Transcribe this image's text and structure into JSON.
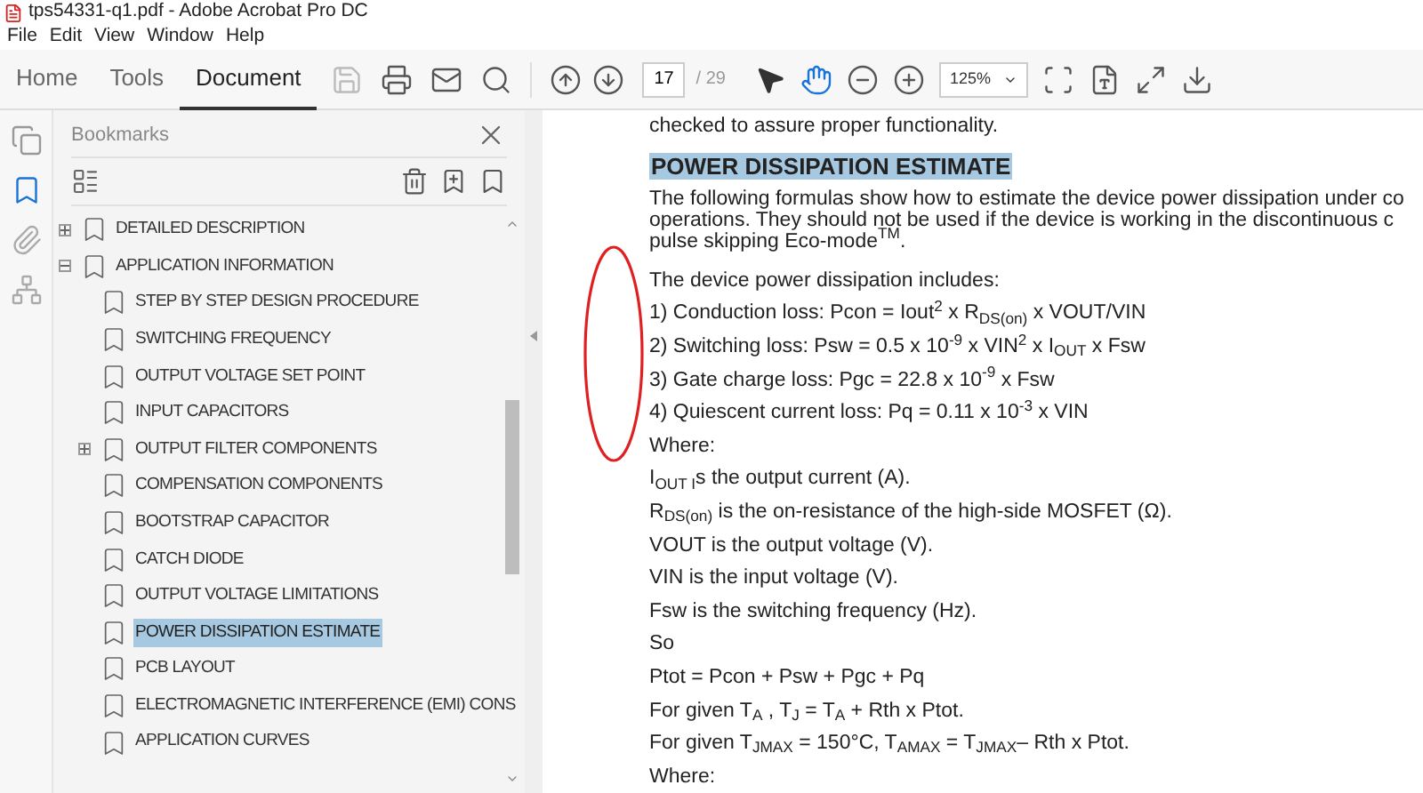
{
  "window": {
    "title": "tps54331-q1.pdf - Adobe Acrobat Pro DC"
  },
  "menu": [
    "File",
    "Edit",
    "View",
    "Window",
    "Help"
  ],
  "tabs": [
    {
      "label": "Home",
      "selected": false
    },
    {
      "label": "Tools",
      "selected": false
    },
    {
      "label": "Document",
      "selected": true
    }
  ],
  "toolbar": {
    "page": "17",
    "page_count": "/ 29",
    "zoom": "125%"
  },
  "bookmarks": {
    "title": "Bookmarks",
    "items": [
      {
        "label": "DETAILED DESCRIPTION",
        "selected": false,
        "expanded": false
      },
      {
        "label": "APPLICATION INFORMATION",
        "selected": false,
        "expanded": true,
        "children": [
          {
            "label": "STEP BY STEP DESIGN PROCEDURE",
            "selected": false
          },
          {
            "label": "SWITCHING FREQUENCY",
            "selected": false
          },
          {
            "label": "OUTPUT VOLTAGE SET POINT",
            "selected": false
          },
          {
            "label": "INPUT CAPACITORS",
            "selected": false
          },
          {
            "label": "OUTPUT FILTER COMPONENTS",
            "selected": false,
            "expanded": false
          },
          {
            "label": "COMPENSATION COMPONENTS",
            "selected": false
          },
          {
            "label": "BOOTSTRAP CAPACITOR",
            "selected": false
          },
          {
            "label": "CATCH DIODE",
            "selected": false
          },
          {
            "label": "OUTPUT VOLTAGE LIMITATIONS",
            "selected": false
          },
          {
            "label": "POWER DISSIPATION ESTIMATE",
            "selected": true
          },
          {
            "label": "PCB LAYOUT",
            "selected": false
          },
          {
            "label": "ELECTROMAGNETIC INTERFERENCE (EMI) CONS",
            "selected": false
          },
          {
            "label": "APPLICATION CURVES",
            "selected": false
          }
        ]
      }
    ]
  },
  "document": {
    "blocks": [
      {
        "kind": "text",
        "text": "checked to assure proper functionality."
      },
      {
        "kind": "heading",
        "text": "POWER DISSIPATION ESTIMATE"
      },
      {
        "kind": "paragraph",
        "lines": [
          "The following formulas show how to estimate the device power dissipation under co",
          "operations. They should not be used if the device is working in the discontinuous c",
          "pulse skipping Eco-mode$^{TM}$."
        ]
      },
      {
        "kind": "text",
        "text": "The device power dissipation includes:"
      },
      {
        "kind": "text",
        "text": "1) Conduction loss: Pcon = Iout$^{2}$ x R$_{DS(on)}$ x VOUT/VIN"
      },
      {
        "kind": "text",
        "text": "2) Switching loss: Psw = 0.5 x 10$^{-9}$ x VIN$^{2}$ x I$_{OUT}$ x Fsw"
      },
      {
        "kind": "text",
        "text": "3) Gate charge loss: Pgc = 22.8 x 10$^{-9}$ x Fsw"
      },
      {
        "kind": "text",
        "text": "4) Quiescent current loss: Pq = 0.11 x 10$^{-3}$ x VIN"
      },
      {
        "kind": "text",
        "text": "Where:"
      },
      {
        "kind": "text",
        "text": "I$_{OUT I}$s the output current (A)."
      },
      {
        "kind": "text",
        "text": "R$_{DS(on)}$ is the on-resistance of the high-side MOSFET (Ω)."
      },
      {
        "kind": "text",
        "text": "VOUT is the output voltage (V)."
      },
      {
        "kind": "text",
        "text": "VIN is the input voltage (V)."
      },
      {
        "kind": "text",
        "text": "Fsw is the switching frequency (Hz)."
      },
      {
        "kind": "text",
        "text": "So"
      },
      {
        "kind": "text",
        "text": "Ptot = Pcon + Psw + Pgc + Pq"
      },
      {
        "kind": "text",
        "text": "For given T$_{A}$ , T$_{J}$ = T$_{A}$ + Rth x Ptot."
      },
      {
        "kind": "text",
        "text": "For given T$_{JMAX}$ = 150°C, T$_{AMAX}$ = T$_{JMAX}$– Rth x Ptot."
      },
      {
        "kind": "text",
        "text": "Where:"
      }
    ]
  }
}
